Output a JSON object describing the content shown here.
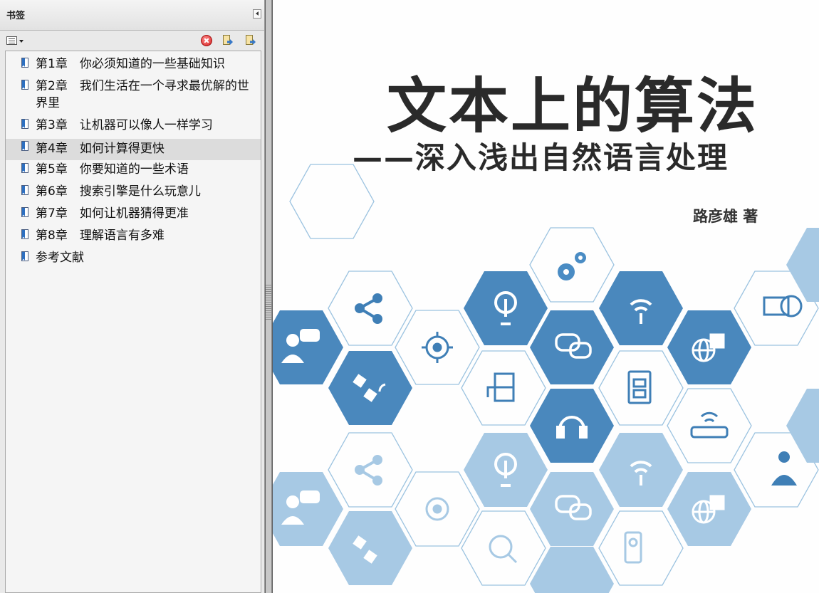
{
  "panel": {
    "title": "书签",
    "bookmarks": [
      {
        "label": "第1章　你必须知道的一些基础知识"
      },
      {
        "label": "第2章　我们生活在一个寻求最优解的世界里"
      },
      {
        "label": "第3章　让机器可以像人一样学习"
      },
      {
        "label": "第4章　如何计算得更快"
      },
      {
        "label": "第5章　你要知道的一些术语"
      },
      {
        "label": "第6章　搜索引擎是什么玩意儿"
      },
      {
        "label": "第7章　如何让机器猜得更准"
      },
      {
        "label": "第8章　理解语言有多难"
      },
      {
        "label": "参考文献"
      }
    ],
    "selected_index": 3
  },
  "page": {
    "title": "文本上的算法",
    "subtitle": "——深入浅出自然语言处理",
    "author": "路彦雄 著"
  },
  "colors": {
    "hex_dark": "#3f7fb6",
    "hex_mid": "#5d98c8",
    "hex_light": "#a9cbe5",
    "hex_outline": "#9cc3e0",
    "icon_white": "#ffffff",
    "icon_blue": "#4a8cc4"
  },
  "icons": [
    "gears-icon",
    "share-icon",
    "lightbulb-icon",
    "wifi-antenna-icon",
    "remote-desktop-icon",
    "user-chat-icon",
    "target-icon",
    "chat-bubbles-icon",
    "globe-user-icon",
    "satellite-icon",
    "server-plug-icon",
    "circuit-board-icon",
    "headset-icon",
    "router-icon",
    "user-gear-icon",
    "globe-search-icon",
    "camera-icon"
  ]
}
